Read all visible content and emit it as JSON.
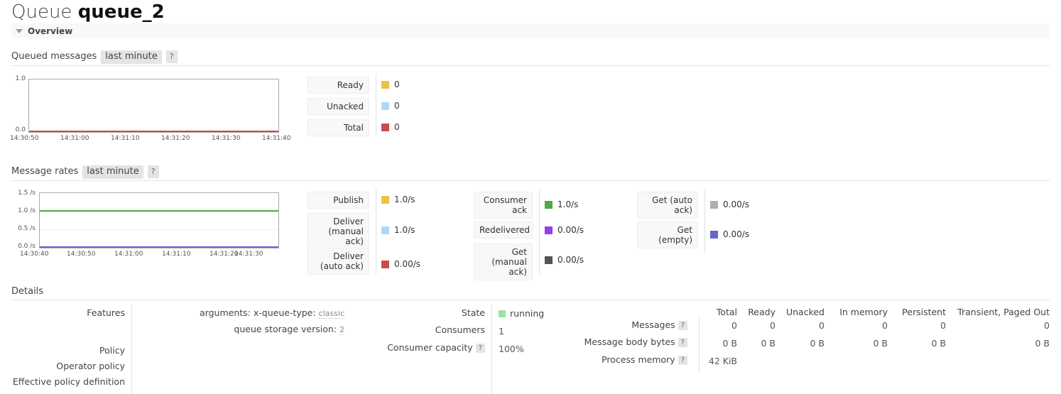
{
  "page": {
    "title_prefix": "Queue",
    "title_object": "queue_2"
  },
  "overview_section": {
    "label": "Overview",
    "toggle_icon": "triangle-down-icon"
  },
  "queued_messages": {
    "heading": "Queued messages",
    "period_chip": "last minute",
    "help": "?",
    "legend": [
      {
        "label": "Ready",
        "value": "0",
        "color": "#edc240"
      },
      {
        "label": "Unacked",
        "value": "0",
        "color": "#afd8f8"
      },
      {
        "label": "Total",
        "value": "0",
        "color": "#cb4b4b"
      }
    ]
  },
  "message_rates": {
    "heading": "Message rates",
    "period_chip": "last minute",
    "help": "?",
    "columns": [
      {
        "rows": [
          {
            "label": "Publish",
            "value": "1.0/s",
            "color": "#edc240"
          },
          {
            "label": "Deliver (manual ack)",
            "value": "1.0/s",
            "color": "#afd8f8"
          },
          {
            "label": "Deliver (auto ack)",
            "value": "0.00/s",
            "color": "#cb4b4b"
          }
        ]
      },
      {
        "rows": [
          {
            "label": "Consumer ack",
            "value": "1.0/s",
            "color": "#4da74d"
          },
          {
            "label": "Redelivered",
            "value": "0.00/s",
            "color": "#9440ed"
          },
          {
            "label": "Get (manual ack)",
            "value": "0.00/s",
            "color": "#555555"
          }
        ]
      },
      {
        "rows": [
          {
            "label": "Get (auto ack)",
            "value": "0.00/s",
            "color": "#afafaf"
          },
          {
            "label": "Get (empty)",
            "value": "0.00/s",
            "color": "#6666cc"
          }
        ]
      }
    ]
  },
  "details": {
    "heading": "Details",
    "left": {
      "labels": [
        "Features",
        "Policy",
        "Operator policy",
        "Effective policy definition"
      ],
      "features": [
        {
          "name": "arguments: x-queue-type:",
          "value": "classic"
        },
        {
          "name": "queue storage version:",
          "value": "2"
        }
      ]
    },
    "middle": {
      "rows": [
        {
          "label": "State",
          "help": false,
          "value": "running",
          "dot": "#9ae59a"
        },
        {
          "label": "Consumers",
          "help": false,
          "value": "1"
        },
        {
          "label": "Consumer capacity",
          "help": true,
          "value": "100%"
        }
      ]
    },
    "right": {
      "columns": [
        "Total",
        "Ready",
        "Unacked",
        "In memory",
        "Persistent",
        "Transient, Paged Out"
      ],
      "rows": [
        {
          "label": "Messages",
          "help": "?",
          "cells": [
            "0",
            "0",
            "0",
            "0",
            "0",
            "0"
          ]
        },
        {
          "label": "Message body bytes",
          "help": "?",
          "cells": [
            "0 B",
            "0 B",
            "0 B",
            "0 B",
            "0 B",
            "0 B"
          ]
        },
        {
          "label": "Process memory",
          "help": "?",
          "cells": [
            "42 KiB",
            "",
            "",
            "",
            "",
            ""
          ]
        }
      ]
    }
  },
  "chart_data": [
    {
      "type": "line",
      "title": "Queued messages",
      "xlabel": "",
      "ylabel": "",
      "ylim": [
        0.0,
        1.0
      ],
      "yticks": [
        "0.0",
        "1.0"
      ],
      "xticks": [
        "14:30:50",
        "14:31:00",
        "14:31:10",
        "14:31:20",
        "14:31:30",
        "14:31:40"
      ],
      "grid": false,
      "legend_position": "right",
      "series": [
        {
          "name": "Ready",
          "color": "#edc240",
          "values": [
            0,
            0,
            0,
            0,
            0,
            0
          ]
        },
        {
          "name": "Unacked",
          "color": "#afd8f8",
          "values": [
            0,
            0,
            0,
            0,
            0,
            0
          ]
        },
        {
          "name": "Total",
          "color": "#cb4b4b",
          "values": [
            0,
            0,
            0,
            0,
            0,
            0
          ]
        }
      ]
    },
    {
      "type": "line",
      "title": "Message rates",
      "xlabel": "",
      "ylabel": "",
      "ylim": [
        0.0,
        1.5
      ],
      "yticks": [
        "1.5 /s",
        "1.0 /s",
        "0.5 /s",
        "0.0 /s"
      ],
      "xticks": [
        "14:30:40",
        "14:30:50",
        "14:31:00",
        "14:31:10",
        "14:31:20",
        "14:31:30"
      ],
      "grid": true,
      "legend_position": "right",
      "series": [
        {
          "name": "Publish",
          "color": "#edc240",
          "values": [
            1.0,
            1.0,
            1.0,
            1.0,
            1.0,
            1.0
          ]
        },
        {
          "name": "Deliver (manual ack)",
          "color": "#afd8f8",
          "values": [
            1.0,
            1.0,
            1.0,
            1.0,
            1.0,
            1.0
          ]
        },
        {
          "name": "Consumer ack",
          "color": "#4da74d",
          "values": [
            1.0,
            1.0,
            1.0,
            1.0,
            1.0,
            1.0
          ]
        },
        {
          "name": "Deliver (auto ack)",
          "color": "#cb4b4b",
          "values": [
            0,
            0,
            0,
            0,
            0,
            0
          ]
        },
        {
          "name": "Redelivered",
          "color": "#9440ed",
          "values": [
            0,
            0,
            0,
            0,
            0,
            0
          ]
        },
        {
          "name": "Get (manual ack)",
          "color": "#555555",
          "values": [
            0,
            0,
            0,
            0,
            0,
            0
          ]
        },
        {
          "name": "Get (auto ack)",
          "color": "#afafaf",
          "values": [
            0,
            0,
            0,
            0,
            0,
            0
          ]
        },
        {
          "name": "Get (empty)",
          "color": "#6666cc",
          "values": [
            0,
            0,
            0,
            0,
            0,
            0
          ]
        }
      ]
    }
  ]
}
